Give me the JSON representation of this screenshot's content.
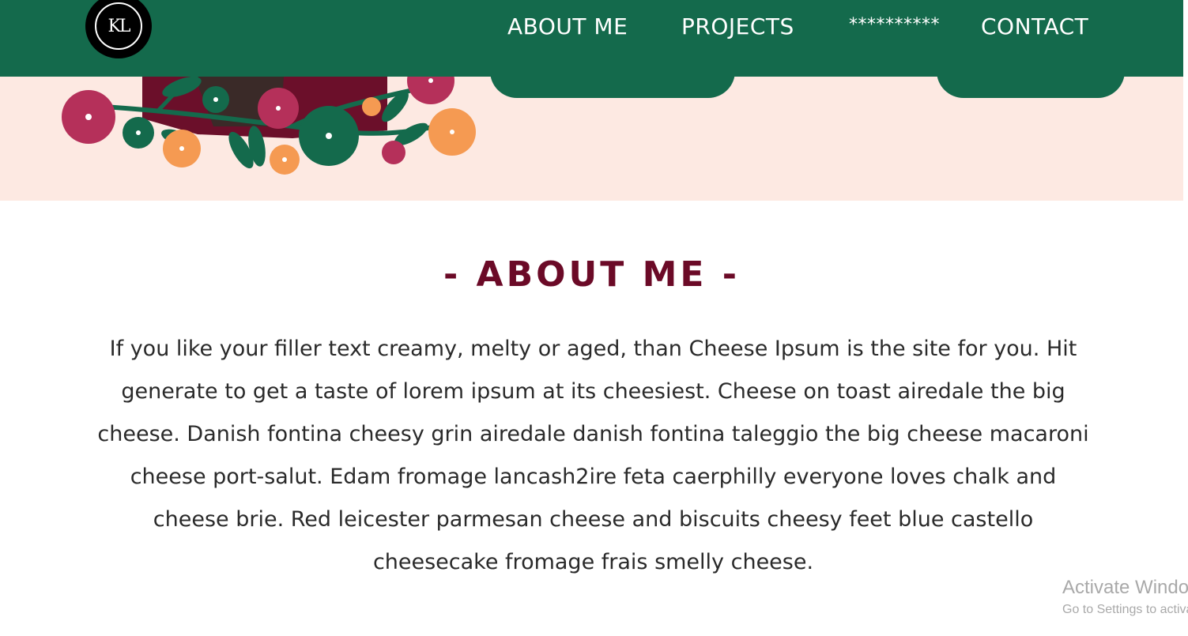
{
  "logo": {
    "text": "KL"
  },
  "nav": {
    "items": [
      {
        "label": "ABOUT ME"
      },
      {
        "label": "PROJECTS"
      },
      {
        "label": "**********"
      },
      {
        "label": "CONTACT"
      }
    ]
  },
  "about": {
    "title": "- ABOUT ME -",
    "body": "If you like your filler text creamy, melty or aged, than Cheese Ipsum is the site for you. Hit generate to get a taste of lorem ipsum at its cheesiest. Cheese on toast airedale the big cheese. Danish fontina cheesy grin airedale danish fontina taleggio the big cheese macaroni cheese port-salut. Edam fromage lancash2ire feta caerphilly everyone loves chalk and cheese brie. Red leicester parmesan cheese and biscuits cheesy feet blue castello cheesecake fromage frais smelly cheese."
  },
  "watermark": {
    "title": "Activate Windows",
    "subtitle": "Go to Settings to activate Windows."
  },
  "colors": {
    "nav_green": "#146a4c",
    "hero_pink": "#fde9e2",
    "title_maroon": "#6b0a27",
    "flower_magenta": "#b5305a",
    "flower_orange": "#f59a52"
  }
}
